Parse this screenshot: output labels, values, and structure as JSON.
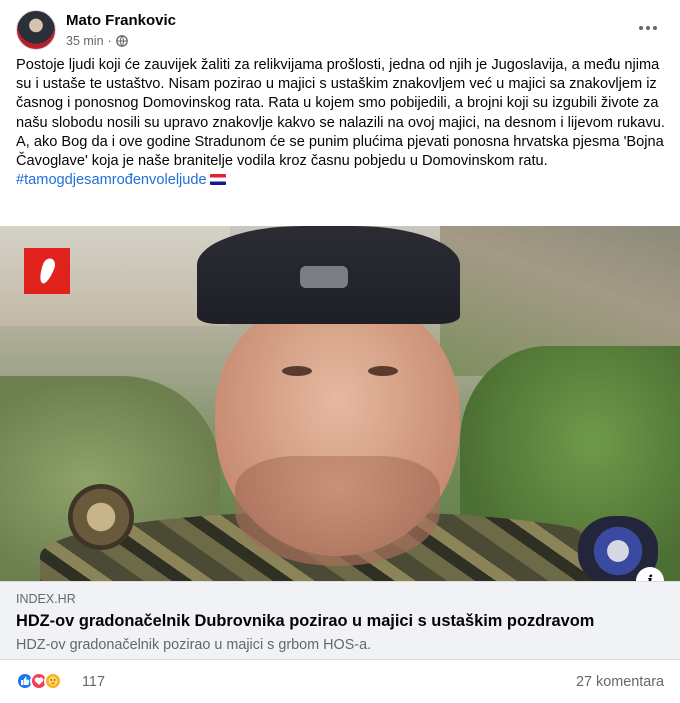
{
  "post": {
    "author": "Mato Frankovic",
    "time": "35 min",
    "separator": "·",
    "paragraphs": [
      "Postoje ljudi koji će zauvijek žaliti za relikvijama prošlosti, jedna od njih je Jugoslavija, a među njima su i ustaše te ustaštvo. Nisam pozirao u majici s ustaškim znakovljem već u majici sa znakovljem iz časnog i ponosnog Domovinskog rata. Rata u kojem smo pobijedili, a brojni koji su izgubili živote za našu slobodu nosili su upravo znakovlje kakvo se nalazili na ovoj majici, na desnom i lijevom rukavu.",
      "A, ako Bog da i ove godine Stradunom će se punim plućima pjevati ponosna hrvatska pjesma 'Bojna Čavoglave' koja je naše branitelje vodila kroz časnu pobjedu u Domovinskom ratu."
    ],
    "hashtag": "#tamogdjesamrođenvoleljude"
  },
  "link_preview": {
    "domain": "INDEX.HR",
    "headline": "HDZ-ov gradonačelnik Dubrovnika pozirao u majici s ustaškim pozdravom",
    "subtitle": "HDZ-ov gradonačelnik pozirao u majici s grbom HOS-a.",
    "info_icon": "i"
  },
  "footer": {
    "reactions": [
      "like-icon",
      "love-icon",
      "care-icon"
    ],
    "reaction_count": "117",
    "comments": "27 komentara"
  },
  "colors": {
    "hashtag": "#216fdb",
    "secondary_text": "#65676b",
    "preview_bg": "#f0f2f5"
  }
}
